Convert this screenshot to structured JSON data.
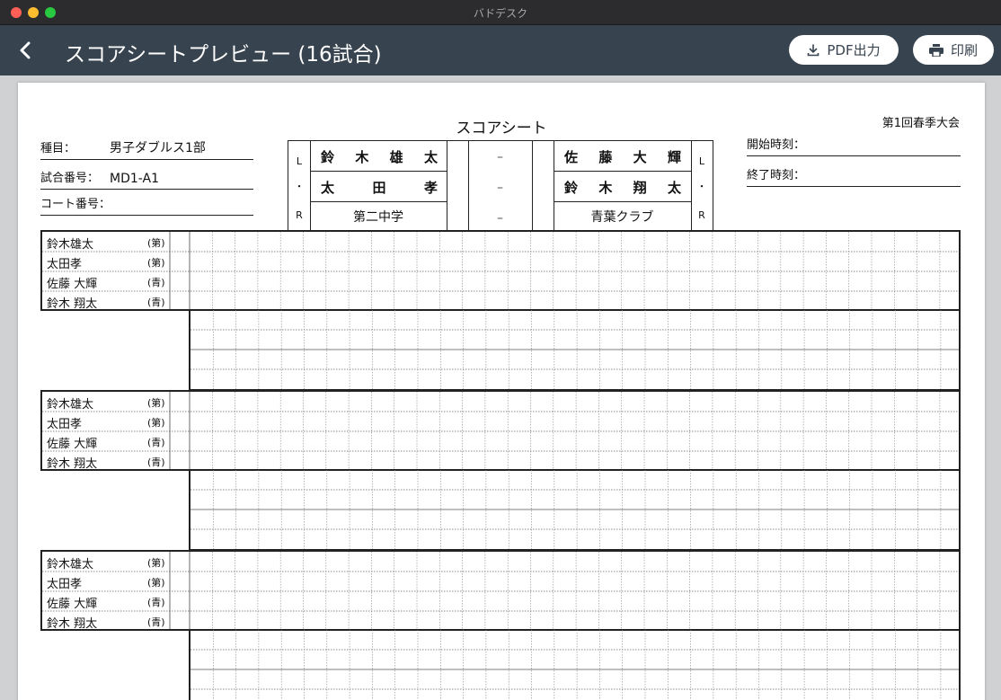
{
  "window": {
    "title": "バドデスク"
  },
  "header": {
    "title": "スコアシートプレビュー (16試合)",
    "pdf_label": "PDF出力",
    "print_label": "印刷"
  },
  "sheet": {
    "title": "スコアシート",
    "tournament": "第1回春季大会",
    "event_label": "種目：",
    "event_value": "男子ダブルス1部",
    "match_no_label": "試合番号：",
    "match_no_value": "MD1-A1",
    "court_label": "コート番号：",
    "start_label": "開始時刻：",
    "end_label": "終了時刻：",
    "lr_top": "L",
    "lr_mid": "・",
    "lr_bottom": "R",
    "left_team": {
      "p1": [
        "鈴",
        "木",
        "雄",
        "太"
      ],
      "p2": [
        "太",
        "田",
        "孝"
      ],
      "team": "第二中学"
    },
    "right_team": {
      "p1": [
        "佐",
        "藤",
        "大",
        "輝"
      ],
      "p2": [
        "鈴",
        "木",
        "翔",
        "太"
      ],
      "team": "青葉クラブ"
    },
    "scores": [
      "–",
      "–",
      "–"
    ],
    "player_rows": [
      {
        "name": "鈴木雄太",
        "aff": "(第)"
      },
      {
        "name": "太田孝",
        "aff": "(第)"
      },
      {
        "name": "佐藤 大輝",
        "aff": "(青)"
      },
      {
        "name": "鈴木 翔太",
        "aff": "(青)"
      }
    ]
  },
  "colors": {
    "appbar": "#37434e",
    "preview_bg": "#cfd1d3"
  }
}
